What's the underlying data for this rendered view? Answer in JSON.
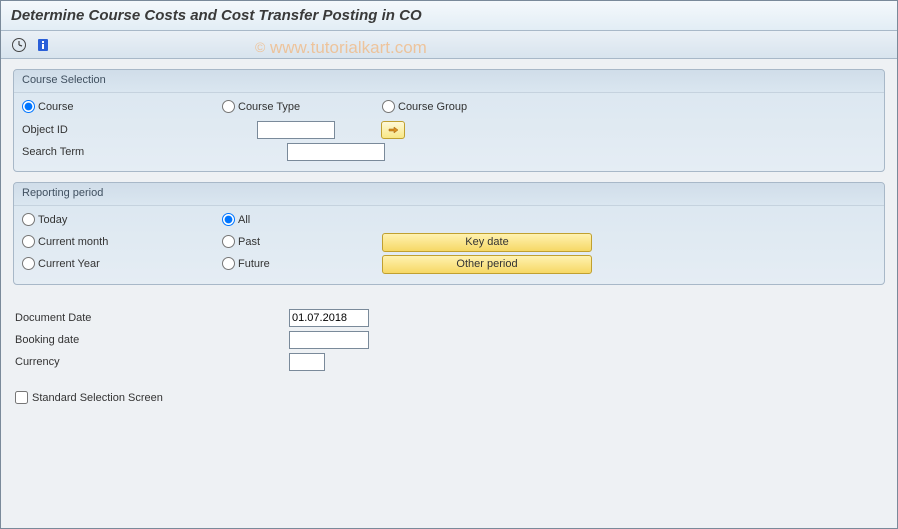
{
  "title": "Determine Course Costs and Cost Transfer Posting in CO",
  "watermark": "www.tutorialkart.com",
  "course_selection": {
    "title": "Course Selection",
    "radio_course": "Course",
    "radio_course_type": "Course Type",
    "radio_course_group": "Course Group",
    "object_id_label": "Object ID",
    "object_id_value": "",
    "search_term_label": "Search Term",
    "search_term_value": ""
  },
  "reporting_period": {
    "title": "Reporting period",
    "radio_today": "Today",
    "radio_all": "All",
    "radio_current_month": "Current month",
    "radio_past": "Past",
    "radio_current_year": "Current Year",
    "radio_future": "Future",
    "btn_key_date": "Key date",
    "btn_other_period": "Other period"
  },
  "fields": {
    "document_date_label": "Document Date",
    "document_date_value": "01.07.2018",
    "booking_date_label": "Booking date",
    "booking_date_value": "",
    "currency_label": "Currency",
    "currency_value": ""
  },
  "checkbox": {
    "standard_selection": "Standard Selection Screen"
  }
}
